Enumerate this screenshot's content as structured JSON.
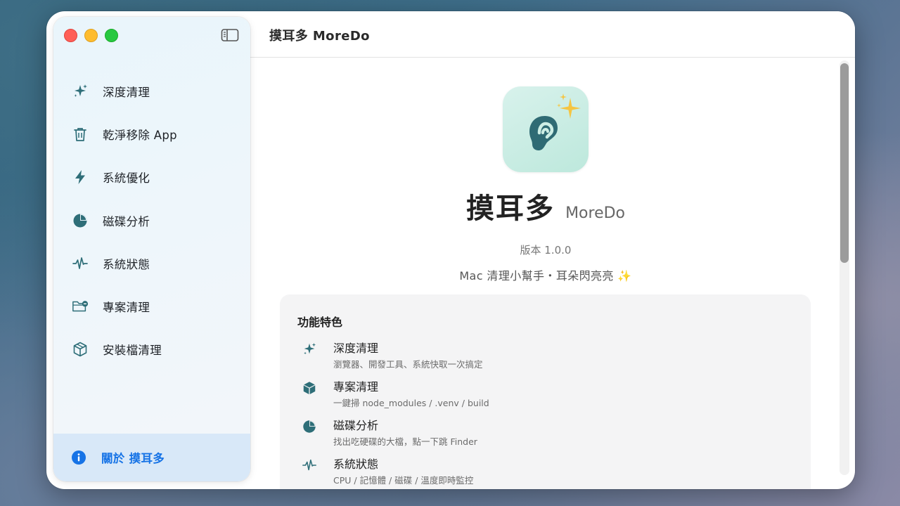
{
  "window": {
    "title": "摸耳多 MoreDo"
  },
  "sidebar": {
    "items": [
      {
        "label": "深度清理",
        "icon": "sparkles-icon"
      },
      {
        "label": "乾淨移除 App",
        "icon": "trash-icon"
      },
      {
        "label": "系統優化",
        "icon": "bolt-icon"
      },
      {
        "label": "磁碟分析",
        "icon": "pie-chart-icon"
      },
      {
        "label": "系統狀態",
        "icon": "waveform-icon"
      },
      {
        "label": "專案清理",
        "icon": "folder-minus-icon"
      },
      {
        "label": "安裝檔清理",
        "icon": "package-icon"
      }
    ],
    "about": {
      "label": "關於 摸耳多",
      "icon": "info-icon"
    }
  },
  "about": {
    "name_zh": "摸耳多",
    "name_en": "MoreDo",
    "version": "版本 1.0.0",
    "tagline": "Mac 清理小幫手・耳朵閃亮亮 ✨"
  },
  "features": {
    "heading": "功能特色",
    "items": [
      {
        "title": "深度清理",
        "desc": "瀏覽器、開發工具、系統快取一次搞定",
        "icon": "sparkles-icon"
      },
      {
        "title": "專案清理",
        "desc": "一鍵掃 node_modules / .venv / build",
        "icon": "cube-icon"
      },
      {
        "title": "磁碟分析",
        "desc": "找出吃硬碟的大檔，點一下跳 Finder",
        "icon": "pie-chart-icon"
      },
      {
        "title": "系統狀態",
        "desc": "CPU / 記憶體 / 磁碟 / 溫度即時監控",
        "icon": "waveform-icon"
      }
    ]
  },
  "colors": {
    "accent": "#1673e6",
    "icon_teal": "#2e6e78",
    "sidebar_selected": "#d8e8f8",
    "traffic_red": "#ff5f57",
    "traffic_yellow": "#febc2e",
    "traffic_green": "#28c840",
    "sparkle_gold": "#f5c542"
  }
}
